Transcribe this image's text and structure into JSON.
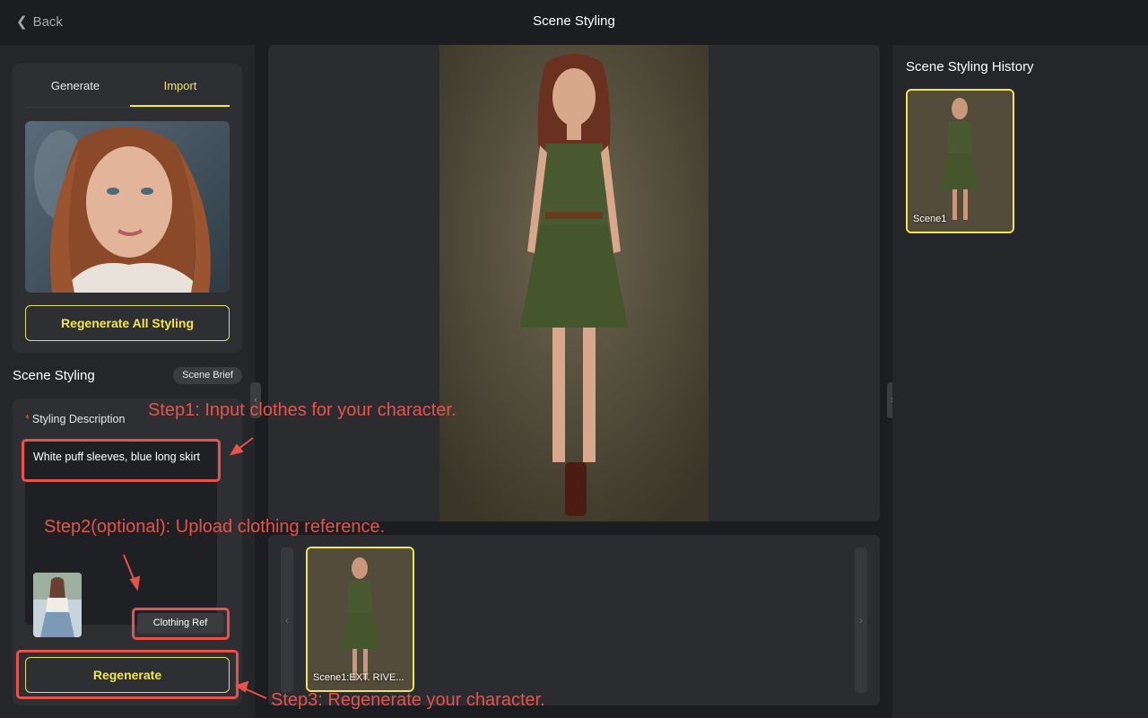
{
  "header": {
    "back_label": "Back",
    "title": "Scene Styling"
  },
  "left": {
    "tabs": [
      {
        "label": "Generate"
      },
      {
        "label": "Import"
      }
    ],
    "regenerate_all_label": "Regenerate All Styling",
    "section_title": "Scene Styling",
    "scene_brief_label": "Scene Brief",
    "styling_label": "Styling Description",
    "required_mark": "*",
    "styling_value": "White puff sleeves, blue long skirt",
    "clothing_ref_label": "Clothing Ref",
    "regenerate_label": "Regenerate"
  },
  "center": {
    "scene_caption": "Scene1:EXT. RIVE..."
  },
  "history": {
    "title": "Scene Styling History",
    "items": [
      {
        "label": "Scene1"
      }
    ]
  },
  "annotations": {
    "step1": "Step1: Input clothes for your character.",
    "step2": "Step2(optional): Upload clothing reference.",
    "step3": "Step3: Regenerate your character."
  },
  "colors": {
    "accent": "#f2e650",
    "annotation": "#e5534b",
    "background": "#1c1d20"
  }
}
